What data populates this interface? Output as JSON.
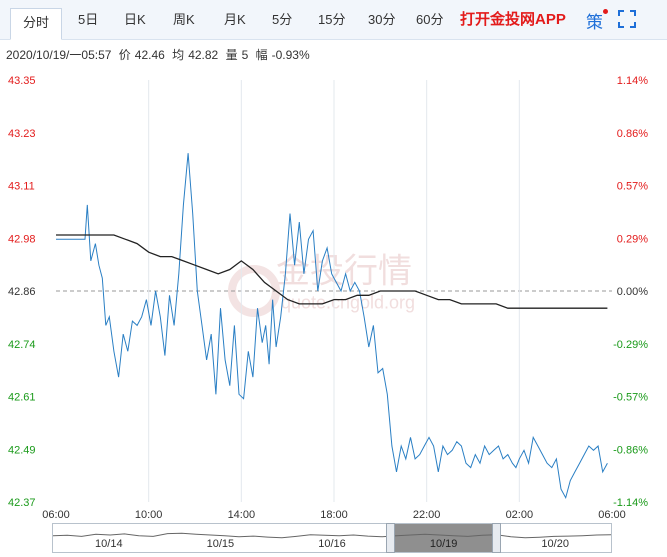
{
  "tabs": [
    {
      "label": "分时",
      "active": true
    },
    {
      "label": "5日"
    },
    {
      "label": "日K"
    },
    {
      "label": "周K"
    },
    {
      "label": "月K"
    },
    {
      "label": "5分"
    },
    {
      "label": "15分"
    },
    {
      "label": "30分"
    },
    {
      "label": "60分"
    }
  ],
  "app_link": "打开金投网APP",
  "ce_icon_label": "策",
  "info": {
    "datetime": "2020/10/19/一05:57",
    "price_label": "价",
    "price": "42.46",
    "avg_label": "均",
    "avg": "42.82",
    "vol_label": "量",
    "vol": "5",
    "change_label": "幅",
    "change": "-0.93%"
  },
  "watermark": {
    "cn": "金投行情",
    "en": "quote.cngold.org"
  },
  "colors": {
    "up": "#e31b1b",
    "down": "#1a9a1a",
    "price_line": "#2a7fc4",
    "avg_line": "#222222",
    "neutral": "#333333"
  },
  "chart_data": {
    "type": "line",
    "ylim": [
      42.37,
      43.35
    ],
    "reference": 42.86,
    "y_ticks_left": [
      "43.35",
      "43.23",
      "43.11",
      "42.98",
      "42.86",
      "42.74",
      "42.61",
      "42.49",
      "42.37"
    ],
    "y_ticks_right": [
      "1.14%",
      "0.86%",
      "0.57%",
      "0.29%",
      "0.00%",
      "-0.29%",
      "-0.57%",
      "-0.86%",
      "-1.14%"
    ],
    "x_ticks": [
      "06:00",
      "10:00",
      "14:00",
      "18:00",
      "22:00",
      "02:00",
      "06:00"
    ],
    "x_range_hours": [
      0,
      24
    ],
    "series": [
      {
        "kind": "price",
        "x": [
          0,
          1.25,
          1.35,
          1.5,
          1.7,
          1.85,
          2.0,
          2.15,
          2.3,
          2.5,
          2.7,
          2.9,
          3.1,
          3.3,
          3.5,
          3.7,
          3.9,
          4.1,
          4.3,
          4.5,
          4.7,
          4.9,
          5.1,
          5.3,
          5.5,
          5.7,
          5.9,
          6.1,
          6.3,
          6.5,
          6.7,
          6.9,
          7.1,
          7.3,
          7.5,
          7.7,
          7.9,
          8.1,
          8.3,
          8.5,
          8.7,
          8.9,
          9.05,
          9.2,
          9.35,
          9.5,
          9.7,
          9.9,
          10.1,
          10.3,
          10.5,
          10.7,
          10.9,
          11.1,
          11.3,
          11.5,
          11.7,
          11.9,
          12.1,
          12.3,
          12.5,
          12.7,
          12.9,
          13.1,
          13.3,
          13.5,
          13.7,
          13.9,
          14.1,
          14.3,
          14.5,
          14.7,
          14.9,
          15.1,
          15.3,
          15.5,
          15.7,
          15.9,
          16.1,
          16.3,
          16.5,
          16.7,
          16.9,
          17.1,
          17.3,
          17.5,
          17.7,
          17.9,
          18.1,
          18.3,
          18.5,
          18.7,
          18.9,
          19.1,
          19.3,
          19.5,
          19.7,
          19.85,
          20.0,
          20.2,
          20.4,
          20.6,
          20.8,
          21.0,
          21.2,
          21.4,
          21.6,
          21.8,
          22.0,
          22.2,
          22.4,
          22.6,
          22.8,
          23.0,
          23.2,
          23.4,
          23.6,
          23.8
        ],
        "y": [
          42.98,
          42.98,
          43.06,
          42.93,
          42.97,
          42.92,
          42.89,
          42.78,
          42.8,
          42.72,
          42.66,
          42.76,
          42.72,
          42.79,
          42.78,
          42.8,
          42.84,
          42.78,
          42.86,
          42.8,
          42.71,
          42.85,
          42.78,
          42.9,
          43.06,
          43.18,
          43.04,
          42.86,
          42.78,
          42.7,
          42.76,
          42.62,
          42.82,
          42.7,
          42.64,
          42.78,
          42.62,
          42.61,
          42.72,
          42.66,
          42.82,
          42.74,
          42.78,
          42.69,
          42.84,
          42.73,
          42.8,
          42.9,
          43.04,
          42.92,
          43.02,
          42.9,
          42.98,
          43.0,
          42.86,
          42.93,
          42.96,
          42.9,
          42.88,
          42.86,
          42.9,
          42.86,
          42.88,
          42.86,
          42.8,
          42.73,
          42.78,
          42.67,
          42.68,
          42.62,
          42.5,
          42.44,
          42.5,
          42.47,
          42.52,
          42.47,
          42.48,
          42.5,
          42.52,
          42.5,
          42.44,
          42.5,
          42.48,
          42.49,
          42.51,
          42.5,
          42.46,
          42.45,
          42.48,
          42.46,
          42.5,
          42.48,
          42.49,
          42.5,
          42.47,
          42.48,
          42.46,
          42.45,
          42.47,
          42.49,
          42.46,
          42.52,
          42.5,
          42.48,
          42.46,
          42.45,
          42.47,
          42.4,
          42.38,
          42.42,
          42.44,
          42.46,
          42.48,
          42.5,
          42.49,
          42.5,
          42.44,
          42.46
        ]
      },
      {
        "kind": "average",
        "x": [
          0,
          1,
          2,
          2.5,
          3,
          3.5,
          4,
          4.5,
          5,
          5.5,
          6,
          6.5,
          7,
          7.5,
          8,
          8.5,
          9,
          9.5,
          10,
          10.5,
          11,
          11.5,
          12,
          12.5,
          13,
          13.5,
          14,
          14.5,
          15,
          15.5,
          16,
          16.5,
          17,
          17.5,
          18,
          18.5,
          19,
          19.5,
          20,
          20.5,
          21,
          21.5,
          22,
          22.5,
          23,
          23.5,
          23.8
        ],
        "y": [
          42.99,
          42.99,
          42.99,
          42.99,
          42.98,
          42.97,
          42.95,
          42.94,
          42.94,
          42.93,
          42.92,
          42.91,
          42.9,
          42.91,
          42.93,
          42.91,
          42.88,
          42.86,
          42.84,
          42.83,
          42.83,
          42.83,
          42.84,
          42.84,
          42.85,
          42.85,
          42.86,
          42.86,
          42.86,
          42.86,
          42.85,
          42.84,
          42.84,
          42.83,
          42.83,
          42.83,
          42.83,
          42.82,
          42.82,
          42.82,
          42.82,
          42.82,
          42.82,
          42.82,
          42.82,
          42.82,
          42.82
        ]
      }
    ]
  },
  "navigator": {
    "dates": [
      "10/14",
      "10/15",
      "10/16",
      "10/19",
      "10/20"
    ],
    "selected": "10/19",
    "window_start": 0.605,
    "window_end": 0.795,
    "trace": [
      0.55,
      0.52,
      0.6,
      0.45,
      0.5,
      0.42,
      0.55,
      0.6,
      0.4,
      0.38,
      0.45,
      0.5,
      0.55,
      0.62,
      0.58,
      0.65,
      0.7,
      0.6,
      0.48,
      0.52,
      0.56,
      0.5,
      0.58,
      0.62,
      0.55,
      0.5,
      0.45,
      0.5,
      0.55,
      0.6,
      0.52,
      0.48,
      0.62,
      0.7,
      0.66,
      0.6,
      0.58,
      0.55,
      0.5,
      0.48
    ]
  }
}
